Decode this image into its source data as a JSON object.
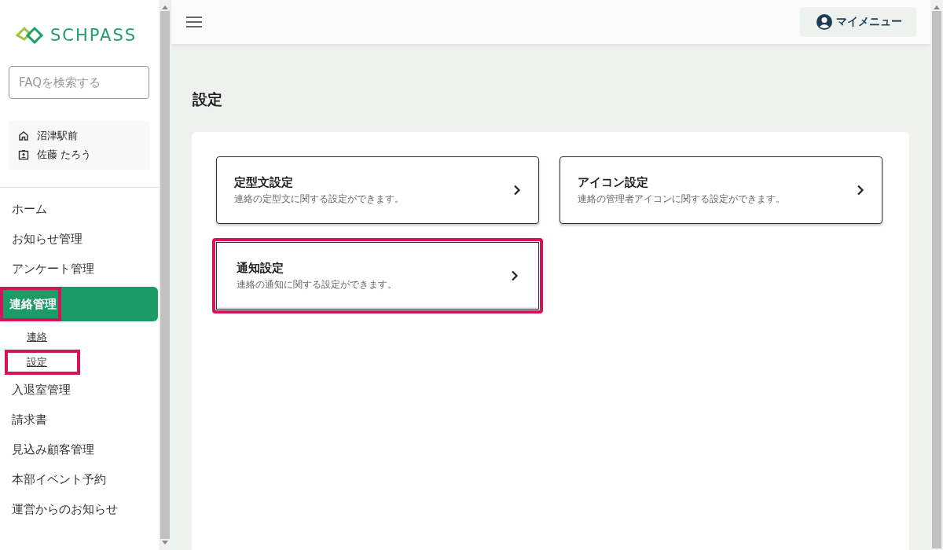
{
  "sidebar": {
    "logo": "SCHPASS",
    "search": {
      "placeholder": "FAQを検索する"
    },
    "info": {
      "place": "沼津駅前",
      "user": "佐藤 たろう"
    },
    "items": [
      {
        "label": "ホーム",
        "selected": false,
        "highlighted": false
      },
      {
        "label": "お知らせ管理",
        "selected": false,
        "highlighted": false
      },
      {
        "label": "アンケート管理",
        "selected": false,
        "highlighted": false
      },
      {
        "label": "連絡管理",
        "selected": true,
        "highlighted": true,
        "children": [
          {
            "label": "連絡",
            "highlighted": false
          },
          {
            "label": "設定",
            "highlighted": true
          }
        ]
      },
      {
        "label": "入退室管理",
        "selected": false,
        "highlighted": false
      },
      {
        "label": "請求書",
        "selected": false,
        "highlighted": false
      },
      {
        "label": "見込み顧客管理",
        "selected": false,
        "highlighted": false
      },
      {
        "label": "本部イベント予約",
        "selected": false,
        "highlighted": false
      },
      {
        "label": "運営からのお知らせ",
        "selected": false,
        "highlighted": false
      }
    ]
  },
  "topbar": {
    "menu_button": "マイメニュー"
  },
  "page_title": "設定",
  "cards": [
    {
      "title": "定型文設定",
      "description": "連絡の定型文に関する設定ができます。",
      "highlighted": false
    },
    {
      "title": "アイコン設定",
      "description": "連絡の管理者アイコンに関する設定ができます。",
      "highlighted": false
    },
    {
      "title": "通知設定",
      "description": "連絡の通知に関する設定ができます。",
      "highlighted": true
    }
  ]
}
